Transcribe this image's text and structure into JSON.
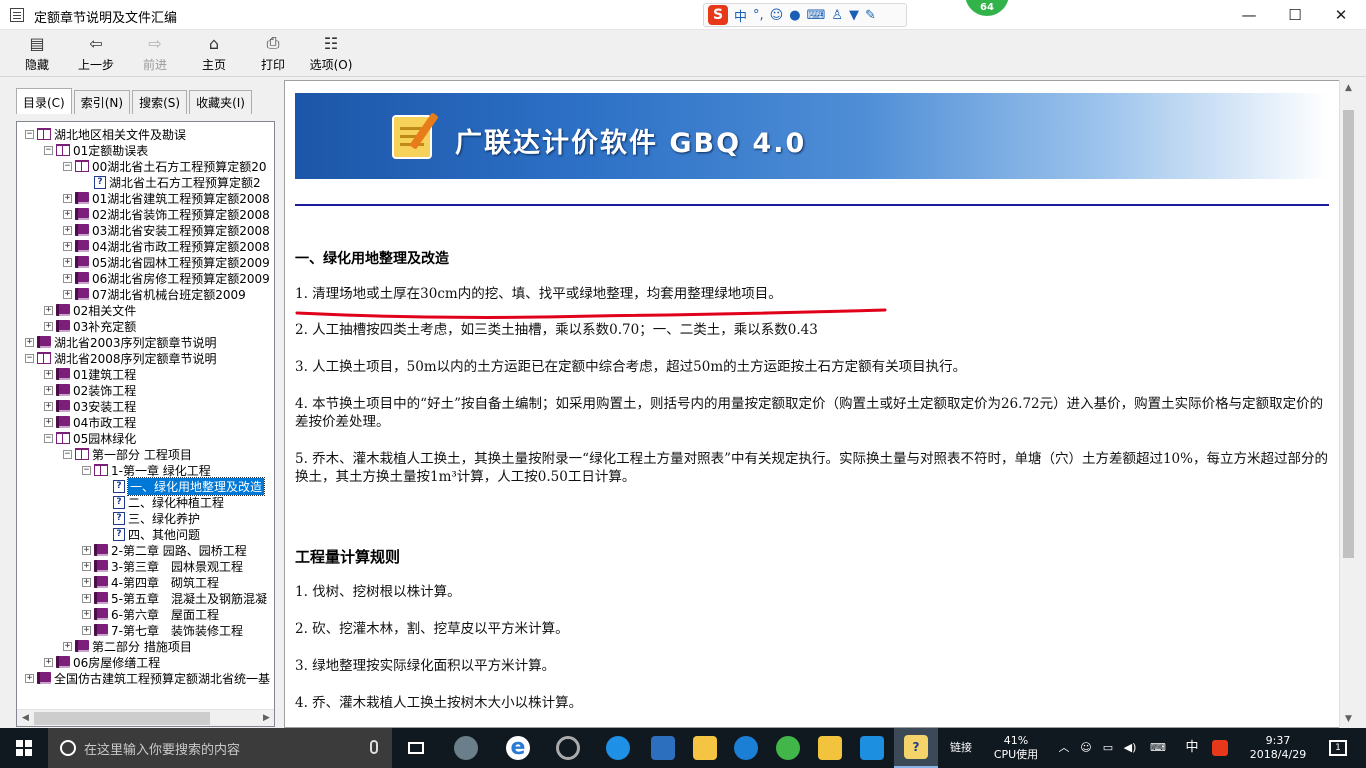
{
  "window": {
    "title": "定额章节说明及文件汇编",
    "minimize_glyph": "—",
    "maximize_glyph": "☐",
    "close_glyph": "✕"
  },
  "ime_bar": {
    "logo": "S",
    "mode": "中",
    "punct": "°,",
    "badge": "64"
  },
  "toolbar": {
    "buttons": [
      {
        "label": "隐藏",
        "icon": "hide-icon"
      },
      {
        "label": "上一步",
        "icon": "back-arrow-icon"
      },
      {
        "label": "前进",
        "icon": "forward-arrow-icon",
        "enabled": false
      },
      {
        "label": "主页",
        "icon": "home-icon"
      },
      {
        "label": "打印",
        "icon": "printer-icon"
      },
      {
        "label": "选项(O)",
        "icon": "options-icon"
      }
    ]
  },
  "nav_tabs": [
    {
      "label": "目录(C)",
      "active": true
    },
    {
      "label": "索引(N)",
      "active": false
    },
    {
      "label": "搜索(S)",
      "active": false
    },
    {
      "label": "收藏夹(I)",
      "active": false
    }
  ],
  "tree": [
    {
      "level": 0,
      "expander": "−",
      "icon": "book-open",
      "label": "湖北地区相关文件及勘误"
    },
    {
      "level": 1,
      "expander": "−",
      "icon": "book-open",
      "label": "01定额勘误表"
    },
    {
      "level": 2,
      "expander": "−",
      "icon": "book-open",
      "label": "00湖北省土石方工程预算定额20"
    },
    {
      "level": 3,
      "expander": "",
      "icon": "page",
      "label": "湖北省土石方工程预算定额2"
    },
    {
      "level": 2,
      "expander": "+",
      "icon": "book-closed",
      "label": "01湖北省建筑工程预算定额2008"
    },
    {
      "level": 2,
      "expander": "+",
      "icon": "book-closed",
      "label": "02湖北省装饰工程预算定额2008"
    },
    {
      "level": 2,
      "expander": "+",
      "icon": "book-closed",
      "label": "03湖北省安装工程预算定额2008"
    },
    {
      "level": 2,
      "expander": "+",
      "icon": "book-closed",
      "label": "04湖北省市政工程预算定额2008"
    },
    {
      "level": 2,
      "expander": "+",
      "icon": "book-closed",
      "label": "05湖北省园林工程预算定额2009"
    },
    {
      "level": 2,
      "expander": "+",
      "icon": "book-closed",
      "label": "06湖北省房修工程预算定额2009"
    },
    {
      "level": 2,
      "expander": "+",
      "icon": "book-closed",
      "label": "07湖北省机械台班定额2009"
    },
    {
      "level": 1,
      "expander": "+",
      "icon": "book-closed",
      "label": "02相关文件"
    },
    {
      "level": 1,
      "expander": "+",
      "icon": "book-closed",
      "label": "03补充定额"
    },
    {
      "level": 0,
      "expander": "+",
      "icon": "book-closed",
      "label": "湖北省2003序列定额章节说明"
    },
    {
      "level": 0,
      "expander": "−",
      "icon": "book-open",
      "label": "湖北省2008序列定额章节说明"
    },
    {
      "level": 1,
      "expander": "+",
      "icon": "book-closed",
      "label": "01建筑工程"
    },
    {
      "level": 1,
      "expander": "+",
      "icon": "book-closed",
      "label": "02装饰工程"
    },
    {
      "level": 1,
      "expander": "+",
      "icon": "book-closed",
      "label": "03安装工程"
    },
    {
      "level": 1,
      "expander": "+",
      "icon": "book-closed",
      "label": "04市政工程"
    },
    {
      "level": 1,
      "expander": "−",
      "icon": "book-open",
      "label": "05园林绿化"
    },
    {
      "level": 2,
      "expander": "−",
      "icon": "book-open",
      "label": "第一部分 工程项目"
    },
    {
      "level": 3,
      "expander": "−",
      "icon": "book-open",
      "label": "1-第一章 绿化工程"
    },
    {
      "level": 4,
      "expander": "",
      "icon": "page",
      "label": "一、绿化用地整理及改造",
      "selected": true
    },
    {
      "level": 4,
      "expander": "",
      "icon": "page",
      "label": "二、绿化种植工程"
    },
    {
      "level": 4,
      "expander": "",
      "icon": "page",
      "label": "三、绿化养护"
    },
    {
      "level": 4,
      "expander": "",
      "icon": "page",
      "label": "四、其他问题"
    },
    {
      "level": 3,
      "expander": "+",
      "icon": "book-closed",
      "label": "2-第二章 园路、园桥工程"
    },
    {
      "level": 3,
      "expander": "+",
      "icon": "book-closed",
      "label": "3-第三章　园林景观工程"
    },
    {
      "level": 3,
      "expander": "+",
      "icon": "book-closed",
      "label": "4-第四章　砌筑工程"
    },
    {
      "level": 3,
      "expander": "+",
      "icon": "book-closed",
      "label": "5-第五章　混凝土及钢筋混凝"
    },
    {
      "level": 3,
      "expander": "+",
      "icon": "book-closed",
      "label": "6-第六章　屋面工程"
    },
    {
      "level": 3,
      "expander": "+",
      "icon": "book-closed",
      "label": "7-第七章　装饰装修工程"
    },
    {
      "level": 2,
      "expander": "+",
      "icon": "book-closed",
      "label": "第二部分 措施项目"
    },
    {
      "level": 1,
      "expander": "+",
      "icon": "book-closed",
      "label": "06房屋修缮工程"
    },
    {
      "level": 0,
      "expander": "+",
      "icon": "book-closed",
      "label": "全国仿古建筑工程预算定额湖北省统一基"
    }
  ],
  "content": {
    "banner_title": "广联达计价软件 GBQ 4.0",
    "section1_heading": "一、绿化用地整理及改造",
    "section1_items": [
      "1. 清理场地或土厚在30cm内的挖、填、找平或绿地整理，均套用整理绿地项目。",
      "2. 人工抽槽按四类土考虑，如三类土抽槽，乘以系数0.70；一、二类土，乘以系数0.43",
      "3. 人工换土项目，50m以内的土方运距已在定额中综合考虑，超过50m的土方运距按土石方定额有关项目执行。",
      "4. 本节换土项目中的“好土”按自备土编制；如采用购置土，则括号内的用量按定额取定价（购置土或好土定额取定价为26.72元）进入基价，购置土实际价格与定额取定价的差按价差处理。",
      "5. 乔木、灌木栽植人工换土，其换土量按附录一“绿化工程土方量对照表”中有关规定执行。实际换土量与对照表不符时，单塘（穴）土方差额超过10%，每立方米超过部分的换土，其土方换土量按1m³计算，人工按0.50工日计算。"
    ],
    "section2_heading": "工程量计算规则",
    "section2_items": [
      "1. 伐树、挖树根以株计算。",
      "2. 砍、挖灌木林，割、挖草皮以平方米计算。",
      "3. 绿地整理按实际绿化面积以平方米计算。",
      "4. 乔、灌木栽植人工换土按树木大小以株计算。"
    ],
    "annotation_color": "#e0001a"
  },
  "taskbar": {
    "search_placeholder": "在这里输入你要搜索的内容",
    "cpu_percent": "41%",
    "cpu_label": "CPU使用",
    "link_label": "链接",
    "ime_label": "中",
    "time": "9:37",
    "date": "2018/4/29",
    "notification_count": "1"
  }
}
